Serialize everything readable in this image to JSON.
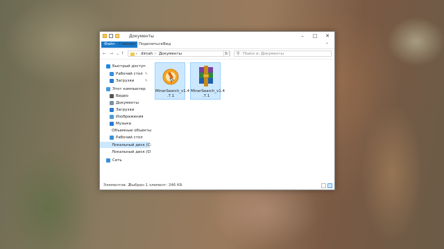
{
  "window": {
    "title": "Документы",
    "minimize": "–",
    "maximize": "□",
    "close": "✕",
    "expand_ribbon": "⌄"
  },
  "ribbon": {
    "tabs": [
      "Файл",
      "Главная",
      "Поделиться",
      "Вид"
    ]
  },
  "navigation": {
    "back": "←",
    "forward": "→",
    "recent": "⌄",
    "up": "↑",
    "path": [
      "dimah",
      "Документы"
    ],
    "refresh": "↻",
    "search_placeholder": "Поиск в: Документы"
  },
  "sidebar": {
    "items": [
      {
        "label": "Быстрый доступ",
        "icon": "star-icon",
        "color": "#1e88e5",
        "indent": 0
      },
      {
        "label": "Рабочий стол",
        "icon": "desktop-icon",
        "color": "#3a8fd6",
        "indent": 1,
        "pinned": true
      },
      {
        "label": "Загрузки",
        "icon": "download-icon",
        "color": "#2b7bd0",
        "indent": 1,
        "pinned": true
      },
      {
        "label": "Этот компьютер",
        "icon": "computer-icon",
        "color": "#4a9ad9",
        "indent": 0
      },
      {
        "label": "Видео",
        "icon": "video-icon",
        "color": "#555555",
        "indent": 1
      },
      {
        "label": "Документы",
        "icon": "documents-icon",
        "color": "#7a8ea5",
        "indent": 1
      },
      {
        "label": "Загрузки",
        "icon": "download-icon",
        "color": "#2b7bd0",
        "indent": 1
      },
      {
        "label": "Изображения",
        "icon": "pictures-icon",
        "color": "#4a9ad9",
        "indent": 1
      },
      {
        "label": "Музыка",
        "icon": "music-icon",
        "color": "#2b7bd0",
        "indent": 1
      },
      {
        "label": "Объемные объекты",
        "icon": "3d-objects-icon",
        "color": "#4a9ad9",
        "indent": 1
      },
      {
        "label": "Рабочий стол",
        "icon": "desktop-icon",
        "color": "#3a8fd6",
        "indent": 1
      },
      {
        "label": "Локальный диск (C:)",
        "icon": "drive-c-icon",
        "color": "#6d7f92",
        "indent": 1,
        "selected": true
      },
      {
        "label": "Локальный диск (D:)",
        "icon": "drive-d-icon",
        "color": "#8a8a8a",
        "indent": 1
      },
      {
        "label": "Сеть",
        "icon": "network-icon",
        "color": "#3a8fd6",
        "indent": 0
      }
    ]
  },
  "files": [
    {
      "name": "MinerSearch_v1.4.7.1",
      "name_line1": "MinerSearch_v1.4",
      "name_line2": ".7.1",
      "icon": "minersearch-app-icon",
      "selected": true
    },
    {
      "name": "MinerSearch_v1.4.7.1",
      "name_line1": "MinerSearch_v1.4",
      "name_line2": ".7.1",
      "icon": "winrar-archive-icon",
      "selected": true
    }
  ],
  "status": {
    "count": "Элементов: 2",
    "selection": "Выбран 1 элемент: 246 КБ"
  },
  "colors": {
    "accent": "#1979ca",
    "selection": "#cce8ff"
  }
}
